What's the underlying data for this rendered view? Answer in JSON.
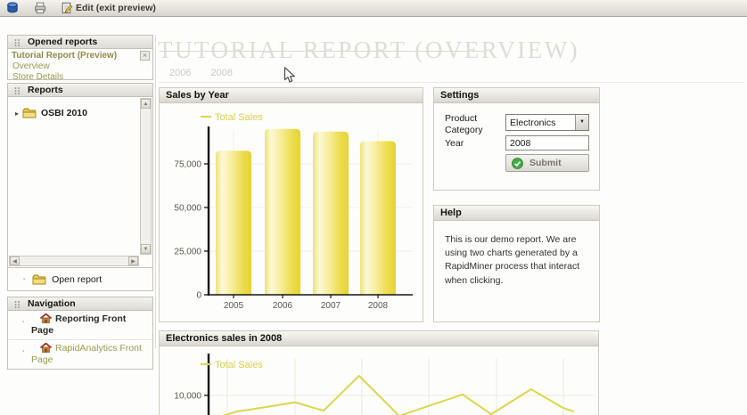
{
  "toolbar": {
    "edit_label": "Edit (exit preview)"
  },
  "sidebar": {
    "opened_reports": {
      "title": "Opened reports",
      "report_name": "Tutorial Report (Preview)",
      "links": [
        "Overview",
        "Store Details"
      ]
    },
    "reports": {
      "title": "Reports",
      "tree_items": [
        "OSBI 2010"
      ],
      "open_report_label": "Open report"
    },
    "navigation": {
      "title": "Navigation",
      "items": [
        "Reporting Front Page",
        "RapidAnalytics Front Page"
      ]
    }
  },
  "main": {
    "title": "TUTORIAL REPORT (OVERVIEW)",
    "tabs": [
      "2006",
      "2008"
    ],
    "settings": {
      "title": "Settings",
      "product_category_label": "Product Category",
      "product_category_value": "Electronics",
      "year_label": "Year",
      "year_value": "2008",
      "submit_label": "Submit"
    },
    "help": {
      "title": "Help",
      "text": "This is our demo report. We are using two charts generated by a RapidMiner process that interact when clicking."
    }
  },
  "chart_data": [
    {
      "type": "bar",
      "title": "Sales by Year",
      "legend": [
        "Total Sales"
      ],
      "legend_position": "top-left",
      "categories": [
        "2005",
        "2006",
        "2007",
        "2008"
      ],
      "values": [
        82500,
        95000,
        93500,
        88000
      ],
      "ylim": [
        0,
        100000
      ],
      "yticks": [
        {
          "value": 0,
          "label": "0"
        },
        {
          "value": 25000,
          "label": "25,000"
        },
        {
          "value": 50000,
          "label": "50,000"
        },
        {
          "value": 75000,
          "label": "75,000"
        }
      ],
      "grid": true,
      "bar_color": "#ecd73f"
    },
    {
      "type": "line",
      "title": "Electronics sales in 2008",
      "legend": [
        "Total Sales"
      ],
      "legend_position": "top-left",
      "yticks": [
        {
          "value": 10000,
          "label": "10,000"
        }
      ],
      "series": [
        {
          "name": "Total Sales",
          "points": [
            {
              "x_frac": 0.0,
              "value": 5100
            },
            {
              "x_frac": 0.05,
              "value": 6300
            },
            {
              "x_frac": 0.113,
              "value": 7100
            },
            {
              "x_frac": 0.214,
              "value": 8400
            },
            {
              "x_frac": 0.294,
              "value": 6500
            },
            {
              "x_frac": 0.394,
              "value": 14500
            },
            {
              "x_frac": 0.507,
              "value": 5300
            },
            {
              "x_frac": 0.686,
              "value": 10200
            },
            {
              "x_frac": 0.766,
              "value": 5700
            },
            {
              "x_frac": 0.879,
              "value": 11400
            },
            {
              "x_frac": 0.97,
              "value": 7100
            },
            {
              "x_frac": 1.0,
              "value": 6300
            }
          ]
        }
      ],
      "grid": true,
      "line_color": "#ddd64f",
      "note": "chart cut off at bottom edge of screenshot; values estimated from 10,000 gridline"
    }
  ],
  "colors": {
    "chart_yellow": "#ddd64f",
    "link_olive": "#9a9a52",
    "submit_green": "#45a945",
    "title_gray": "#deddd3"
  }
}
